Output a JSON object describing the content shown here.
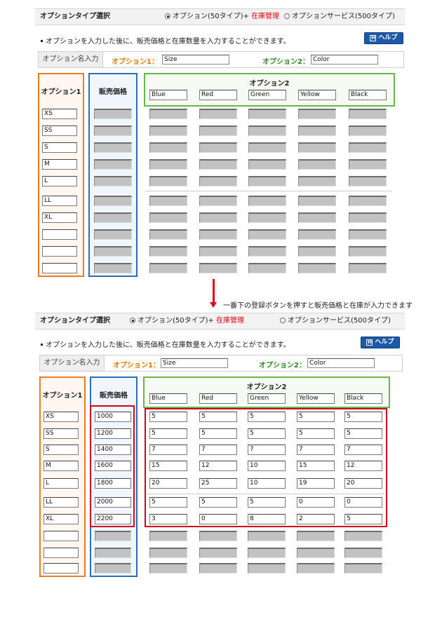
{
  "header": {
    "type_label": "オプションタイプ選択",
    "radio_option50": "オプション(50タイプ)+",
    "radio_stock": "在庫管理",
    "radio_service": "オプションサービス(500タイプ)"
  },
  "notice": "オプションを入力した後に、販売価格と在庫数量を入力することができます。",
  "help_label": "ヘルプ",
  "option_names": {
    "head": "オプション名入力",
    "opt1_label": "オプション1：",
    "opt1_value": "Size",
    "opt2_label": "オプション2：",
    "opt2_value": "Color"
  },
  "columns": {
    "option1": "オプション1",
    "price": "販売価格",
    "option2": "オプション2"
  },
  "colors": [
    "Blue",
    "Red",
    "Green",
    "Yellow",
    "Black"
  ],
  "sizes_before": [
    "XS",
    "SS",
    "S",
    "M",
    "L",
    "LL",
    "XL",
    "",
    "",
    ""
  ],
  "annotation": "一番下の登録ボタンを押すと販売価格と在庫が入力できます",
  "after": {
    "sizes": [
      "XS",
      "SS",
      "S",
      "M",
      "L",
      "LL",
      "XL",
      "",
      "",
      ""
    ],
    "prices": [
      "1000",
      "1200",
      "1400",
      "1600",
      "1800",
      "2000",
      "2200"
    ],
    "stock": [
      [
        "5",
        "5",
        "5",
        "5",
        "5"
      ],
      [
        "5",
        "5",
        "5",
        "5",
        "5"
      ],
      [
        "7",
        "7",
        "7",
        "7",
        "7"
      ],
      [
        "15",
        "12",
        "10",
        "15",
        "12"
      ],
      [
        "20",
        "25",
        "10",
        "19",
        "20"
      ],
      [
        "5",
        "5",
        "5",
        "0",
        "0"
      ],
      [
        "3",
        "0",
        "8",
        "2",
        "5"
      ]
    ]
  },
  "theme": {
    "orange": "#f07a1e",
    "blue": "#2a6fb8",
    "green": "#64b84c",
    "red": "#d7001a",
    "help_blue": "#1c5aa8"
  }
}
